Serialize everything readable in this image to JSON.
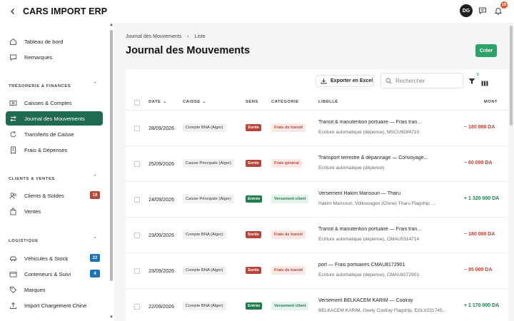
{
  "app": {
    "title": "CARS IMPORT ERP",
    "user_initials": "DG",
    "notification_count": "19"
  },
  "sidebar": {
    "top_items": [
      {
        "label": "Tableau de bord",
        "icon": "home-icon"
      },
      {
        "label": "Remarques",
        "icon": "comment-icon"
      }
    ],
    "sections": [
      {
        "label": "TRÉSORERIE & FINANCES",
        "items": [
          {
            "label": "Caisses & Comptes",
            "icon": "cash-icon"
          },
          {
            "label": "Journal des Mouvements",
            "icon": "arrows-swap-icon",
            "active": true
          },
          {
            "label": "Transferts de Caisse",
            "icon": "refresh-icon"
          },
          {
            "label": "Frais & Dépenses",
            "icon": "receipt-icon"
          }
        ]
      },
      {
        "label": "CLIENTS & VENTES",
        "items": [
          {
            "label": "Clients & Soldes",
            "icon": "users-icon",
            "badge": "19",
            "badge_color": "#b5473a"
          },
          {
            "label": "Ventes",
            "icon": "bag-icon"
          }
        ]
      },
      {
        "label": "LOGISTIQUE",
        "items": [
          {
            "label": "Véhicules & Stock",
            "icon": "car-icon",
            "badge": "22",
            "badge_color": "#1c74b8"
          },
          {
            "label": "Conteneurs & Suivi",
            "icon": "container-icon",
            "badge": "4",
            "badge_color": "#1c74b8"
          },
          {
            "label": "Marques",
            "icon": "tag-icon"
          },
          {
            "label": "Import Chargement Chine",
            "icon": "upload-icon"
          }
        ]
      }
    ]
  },
  "main": {
    "breadcrumb": [
      "Journal des Mouvements",
      "Liste"
    ],
    "title": "Journal des Mouvements",
    "create_label": "Créer",
    "export_label": "Exporter en Excel",
    "search_placeholder": "Rechercher",
    "filter_count": "0",
    "columns": [
      "DATE",
      "CAISSE",
      "SENS",
      "CATÉGORIE",
      "LIBELLÉ",
      "MONT"
    ],
    "rows": [
      {
        "date": "28/09/2026",
        "caisse": "Compte BNA (Alger)",
        "sens": "Sortie",
        "categorie": "Frais de transit",
        "libelle": "Transit & manutention portuaire — Frais tran...",
        "detail": "Écriture automatique (dépense), MSCU9284710",
        "montant": "− 180 000 DA"
      },
      {
        "date": "25/09/2026",
        "caisse": "Caisse Principale (Alger)",
        "sens": "Sortie",
        "categorie": "Frais général",
        "libelle": "Transport terrestre & dépannage — Convoyage...",
        "detail": "Écriture automatique (dépense)",
        "montant": "− 60 000 DA"
      },
      {
        "date": "24/09/2026",
        "caisse": "Caisse Principale (Alger)",
        "sens": "Entrée",
        "categorie": "Versement client",
        "libelle": "Versement Hakim Mansouri — Tharu",
        "detail": "Hakim Mansouri, Volkswagen (Chine) Tharu Flagship, ...",
        "montant": "+ 1 320 000 DA"
      },
      {
        "date": "23/09/2026",
        "caisse": "Compte BNA (Alger)",
        "sens": "Sortie",
        "categorie": "Frais de transit",
        "libelle": "Transit & manutention portuaire — Frais tran...",
        "detail": "Écriture automatique (dépense), CMAU5314714",
        "montant": "− 180 000 DA"
      },
      {
        "date": "23/09/2026",
        "caisse": "Compte BNA (Alger)",
        "sens": "Sortie",
        "categorie": "Frais de transit",
        "libelle": "port — Frais portuaires CMAU8172901",
        "detail": "Écriture automatique (dépense), CMAU8172901",
        "montant": "− 95 000 DA"
      },
      {
        "date": "22/09/2026",
        "caisse": "Compte BNA (Alger)",
        "sens": "Entrée",
        "categorie": "Versement client",
        "libelle": "Versement BELKACEM KARIM — Coolray",
        "detail": "BELKACEM KARIM, Geely Coolray Flagship, EGLV231745...",
        "montant": "+ 1 170 000 DA"
      }
    ]
  },
  "colors": {
    "accent": "#1e6b4f",
    "create": "#2da36a",
    "sortie": "#b5473a",
    "entree": "#1f7a4d",
    "cat_transit_bg": "#fde7e4",
    "cat_transit_fg": "#b5473a",
    "cat_client_bg": "#e3f4ea",
    "cat_client_fg": "#1f7a4d",
    "amount_neg": "#b5473a",
    "amount_pos": "#1f7a4d"
  }
}
